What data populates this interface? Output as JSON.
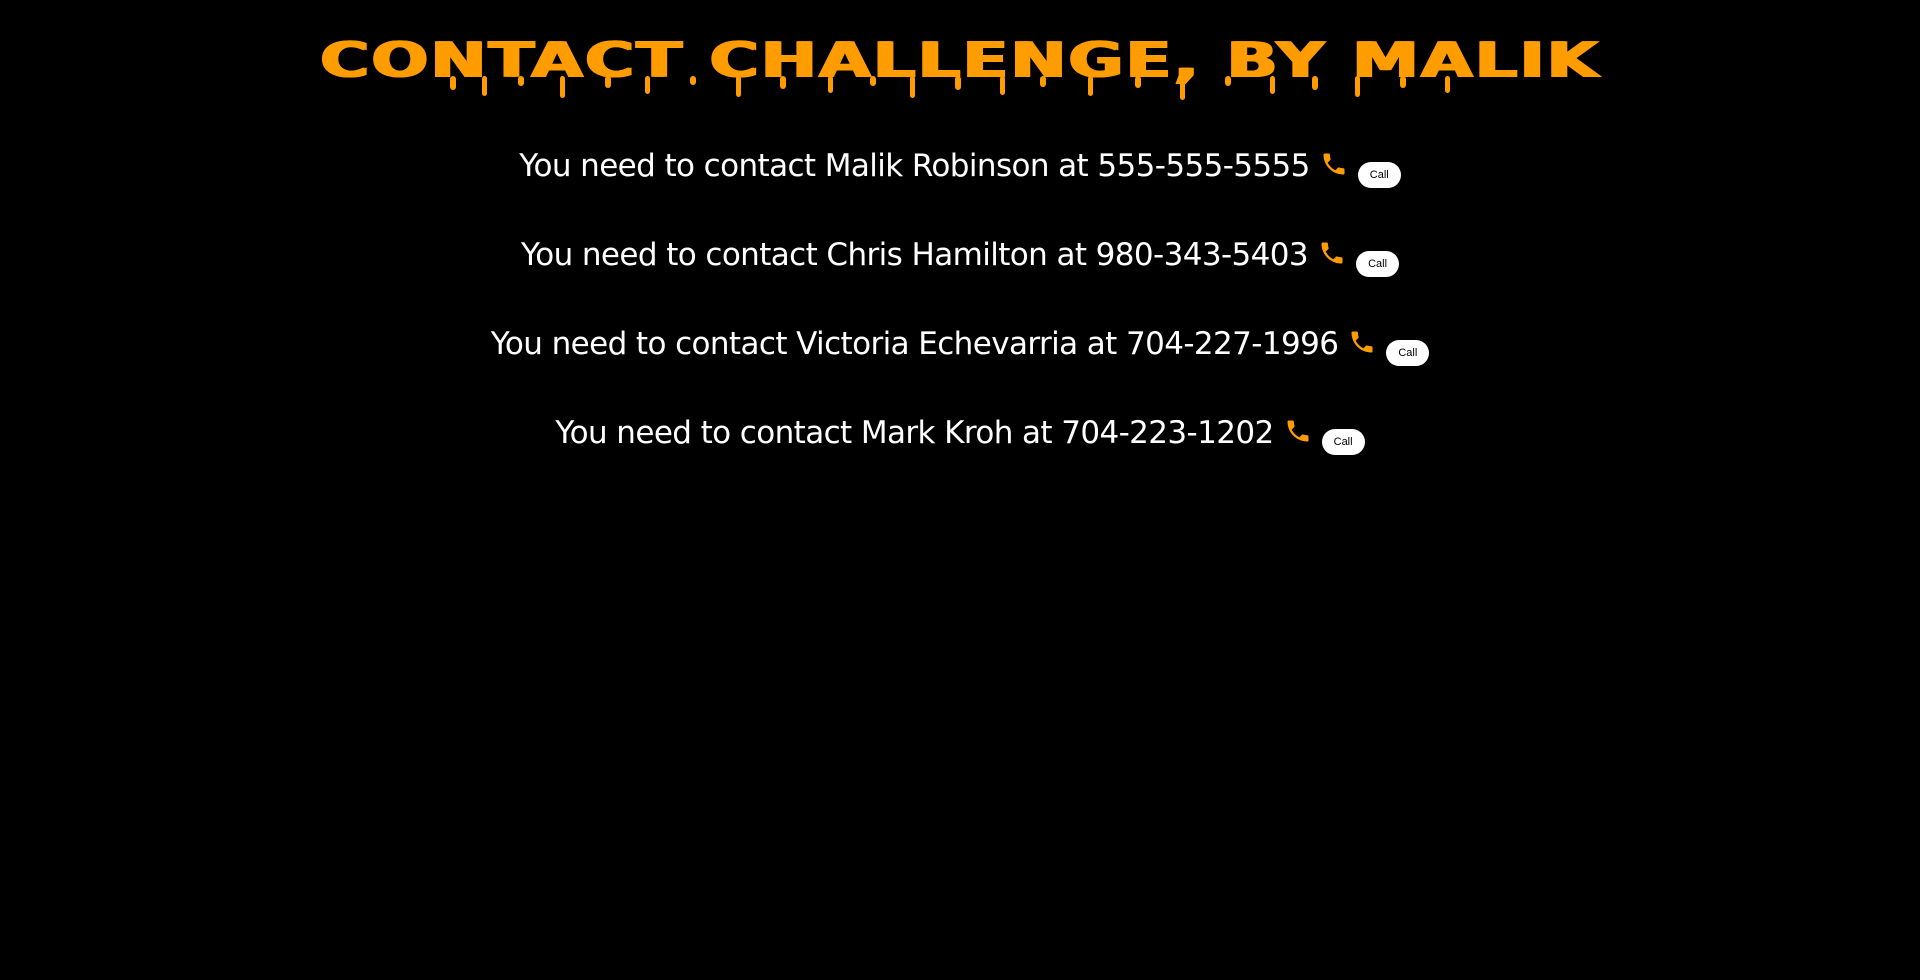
{
  "page": {
    "title": "Contact Challenge, By Malik"
  },
  "theme": {
    "background": "#000000",
    "accent": "#ff9c00",
    "text": "#ffffff"
  },
  "contacts": [
    {
      "text": "You need to contact Malik Robinson at 555-555-5555",
      "icon": "phone-icon",
      "button_label": "Call"
    },
    {
      "text": "You need to contact Chris Hamilton at 980-343-5403",
      "icon": "phone-icon",
      "button_label": "Call"
    },
    {
      "text": "You need to contact Victoria Echevarria at 704-227-1996",
      "icon": "phone-icon",
      "button_label": "Call"
    },
    {
      "text": "You need to contact Mark Kroh at 704-223-1202",
      "icon": "phone-icon",
      "button_label": "Call"
    }
  ]
}
